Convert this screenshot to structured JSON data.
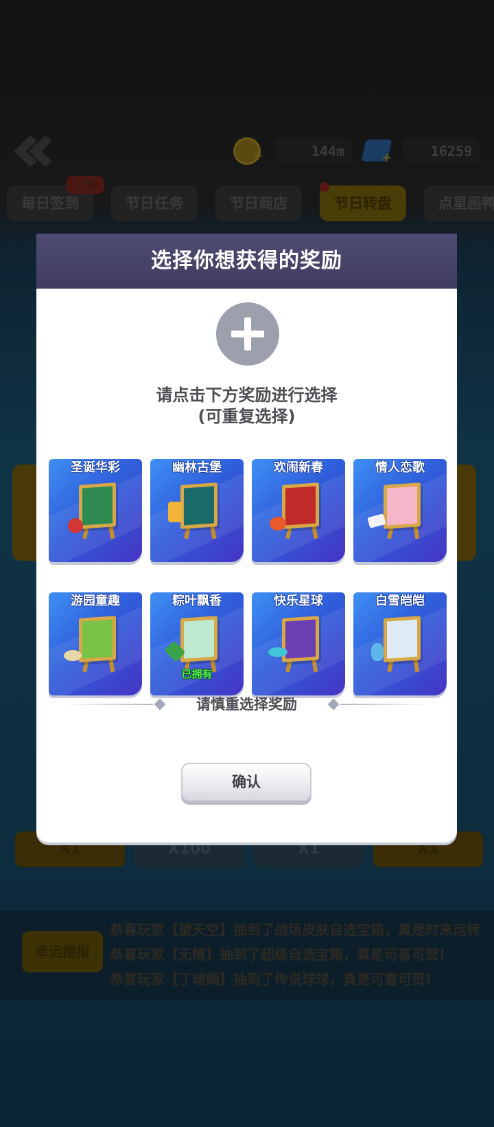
{
  "background": {
    "coins": "144m",
    "gems": "16259",
    "tabs": [
      {
        "label": "每日签到",
        "active": false
      },
      {
        "label": "节日任务",
        "active": false
      },
      {
        "label": "节日商店",
        "active": false
      },
      {
        "label": "节日转盘",
        "active": true
      },
      {
        "label": "点星画鸭",
        "active": false
      }
    ],
    "hot_badge": "火爆",
    "counts": [
      "X1",
      "X100",
      "X1",
      "X1"
    ],
    "ticker": {
      "label": "幸运播报",
      "lines": [
        "恭喜玩家【望天空】抽到了战场皮肤自选宝箱，真是时来运转",
        "恭喜玩家【无情】抽到了超级自选宝箱，真是可喜可贺!",
        "恭喜玩家【丁瑞娴】抽到了传说球球，真是可喜可贺!"
      ]
    }
  },
  "modal": {
    "title": "选择你想获得的奖励",
    "hint_line1": "请点击下方奖励进行选择",
    "hint_line2": "(可重复选择)",
    "rewards": [
      {
        "name": "圣诞华彩",
        "owned": false,
        "theme": "christmas-wreath"
      },
      {
        "name": "幽林古堡",
        "owned": false,
        "theme": "lantern-castle"
      },
      {
        "name": "欢闹新春",
        "owned": false,
        "theme": "spring-festival"
      },
      {
        "name": "情人恋歌",
        "owned": false,
        "theme": "valentine-couple"
      },
      {
        "name": "游园童趣",
        "owned": false,
        "theme": "park-fun"
      },
      {
        "name": "粽叶飘香",
        "owned": true,
        "theme": "zongzi"
      },
      {
        "name": "快乐星球",
        "owned": false,
        "theme": "happy-planet"
      },
      {
        "name": "白雪皑皑",
        "owned": false,
        "theme": "snow"
      }
    ],
    "owned_label": "已拥有",
    "divider_text": "请慎重选择奖励",
    "confirm_label": "确认"
  }
}
